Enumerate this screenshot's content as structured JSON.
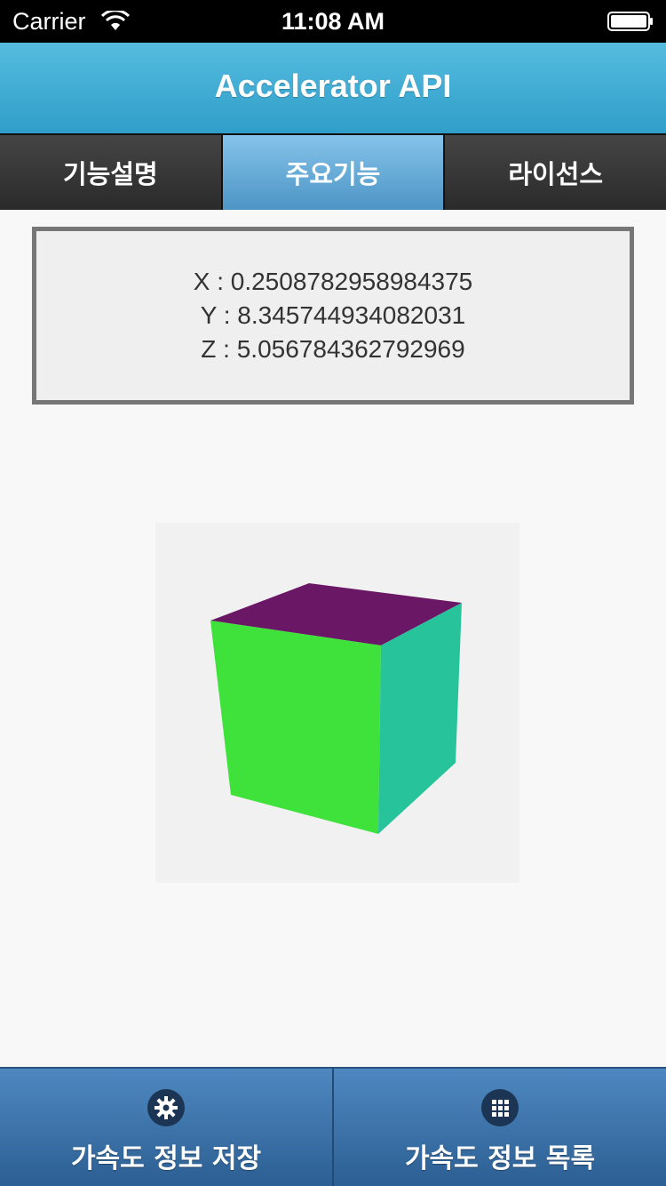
{
  "status_bar": {
    "carrier": "Carrier",
    "time": "11:08 AM"
  },
  "header": {
    "title": "Accelerator API"
  },
  "tabs": [
    {
      "label": "기능설명",
      "active": false
    },
    {
      "label": "주요기능",
      "active": true
    },
    {
      "label": "라이선스",
      "active": false
    }
  ],
  "readout": {
    "x": "X : 0.2508782958984375",
    "y": "Y : 8.345744934082031",
    "z": "Z : 5.056784362792969"
  },
  "cube": {
    "top_color": "#6a1866",
    "front_color": "#3ee23a",
    "side_color": "#27c39a"
  },
  "bottom_bar": {
    "save_label": "가속도 정보 저장",
    "save_icon": "gear-icon",
    "list_label": "가속도 정보 목록",
    "list_icon": "grid-icon"
  }
}
